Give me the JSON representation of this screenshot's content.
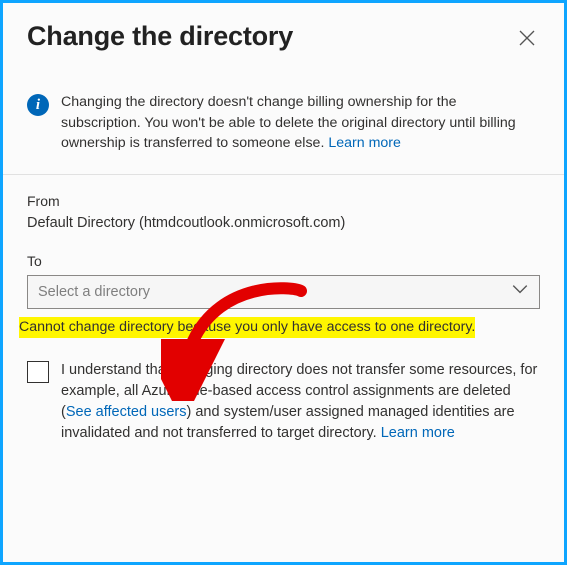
{
  "header": {
    "title": "Change the directory"
  },
  "info": {
    "text": "Changing the directory doesn't change billing ownership for the subscription. You won't be able to delete the original directory until billing ownership is transferred to someone else. ",
    "learn_more": "Learn more"
  },
  "from": {
    "label": "From",
    "value": "Default Directory (htmdcoutlook.onmicrosoft.com)"
  },
  "to": {
    "label": "To",
    "placeholder": "Select a directory"
  },
  "error": "Cannot change directory because you only have access to one directory.",
  "confirm": {
    "text_a": "I understand that changing directory does not transfer some resources, for example, all Azure role-based access control assignments are deleted (",
    "affected_link": "See affected users",
    "text_b": ") and system/user assigned managed identities are invalidated and not transferred to target directory. ",
    "learn_more": "Learn more"
  }
}
